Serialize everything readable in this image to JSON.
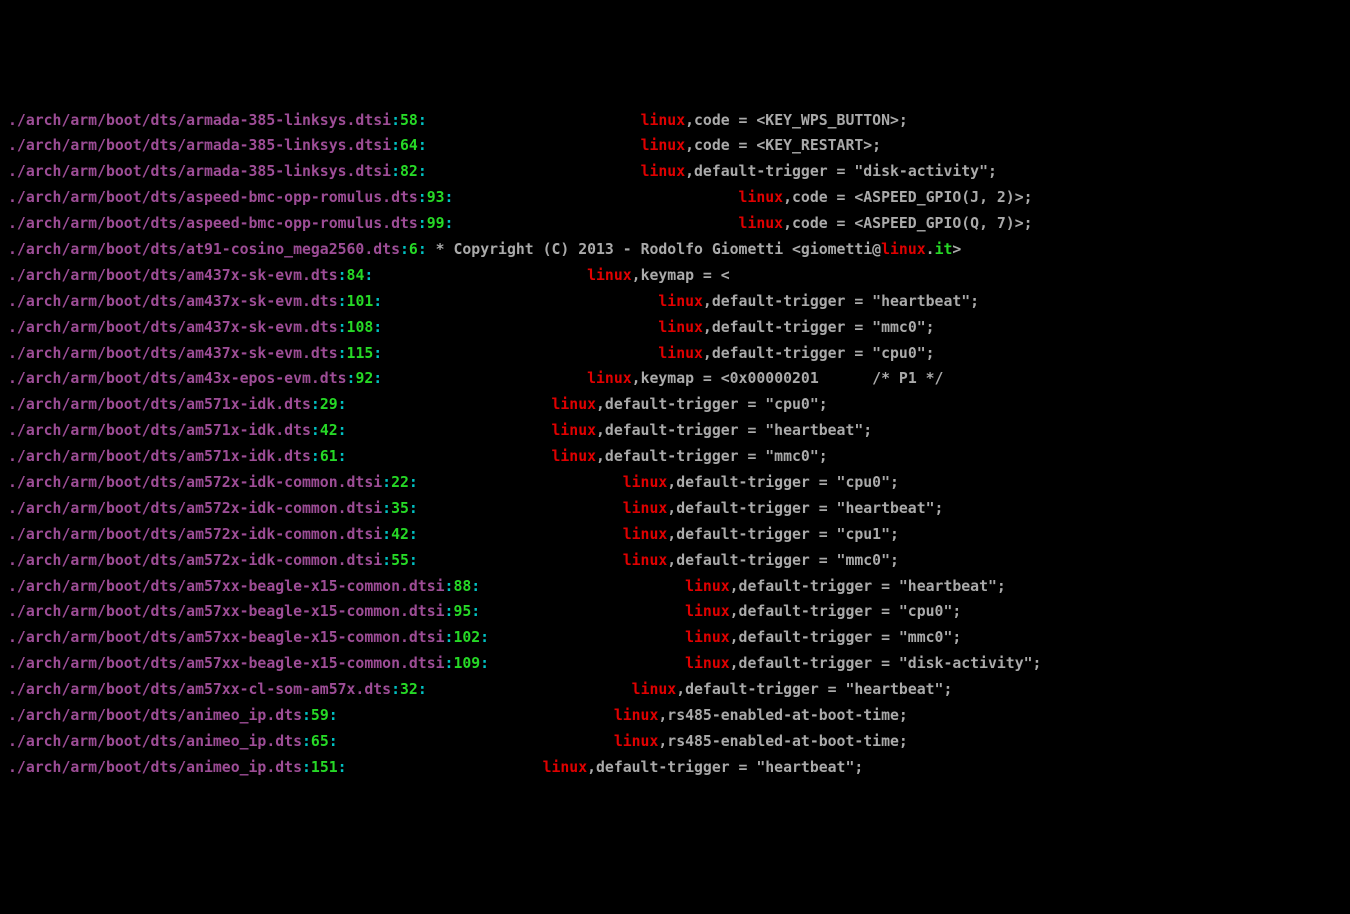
{
  "lines": [
    {
      "path": "./arch/arm/boot/dts/armada-385-linksys.dtsi",
      "lineno": "58",
      "pad": "                        ",
      "prefix": "",
      "linux": "linux",
      "after1": ",code = <KEY_WPS_BUTTON>;"
    },
    {
      "path": "./arch/arm/boot/dts/armada-385-linksys.dtsi",
      "lineno": "64",
      "pad": "                        ",
      "prefix": "",
      "linux": "linux",
      "after1": ",code = <KEY_RESTART>;"
    },
    {
      "path": "./arch/arm/boot/dts/armada-385-linksys.dtsi",
      "lineno": "82",
      "pad": "                        ",
      "prefix": "",
      "linux": "linux",
      "after1": ",default-trigger = \"disk-activity\";"
    },
    {
      "path": "./arch/arm/boot/dts/aspeed-bmc-opp-romulus.dts",
      "lineno": "93",
      "pad": "                                ",
      "prefix": "",
      "linux": "linux",
      "after1": ",code = <ASPEED_GPIO(J, 2)>;"
    },
    {
      "path": "./arch/arm/boot/dts/aspeed-bmc-opp-romulus.dts",
      "lineno": "99",
      "pad": "                                ",
      "prefix": "",
      "linux": "linux",
      "after1": ",code = <ASPEED_GPIO(Q, 7)>;"
    },
    {
      "path": "./arch/arm/boot/dts/at91-cosino_mega2560.dts",
      "lineno": "6",
      "pad": " ",
      "prefix": "* Copyright (C) 2013 - Rodolfo Giometti <giometti@",
      "linux": "linux",
      "after1": ".",
      "it": "it",
      "after2": ">"
    },
    {
      "path": "./arch/arm/boot/dts/am437x-sk-evm.dts",
      "lineno": "84",
      "pad": "                        ",
      "prefix": "",
      "linux": "linux",
      "after1": ",keymap = <"
    },
    {
      "path": "./arch/arm/boot/dts/am437x-sk-evm.dts",
      "lineno": "101",
      "pad": "                               ",
      "prefix": "",
      "linux": "linux",
      "after1": ",default-trigger = \"heartbeat\";"
    },
    {
      "path": "./arch/arm/boot/dts/am437x-sk-evm.dts",
      "lineno": "108",
      "pad": "                               ",
      "prefix": "",
      "linux": "linux",
      "after1": ",default-trigger = \"mmc0\";"
    },
    {
      "path": "./arch/arm/boot/dts/am437x-sk-evm.dts",
      "lineno": "115",
      "pad": "                               ",
      "prefix": "",
      "linux": "linux",
      "after1": ",default-trigger = \"cpu0\";"
    },
    {
      "path": "./arch/arm/boot/dts/am43x-epos-evm.dts",
      "lineno": "92",
      "pad": "                       ",
      "prefix": "",
      "linux": "linux",
      "after1": ",keymap = <0x00000201      /* P1 */"
    },
    {
      "path": "./arch/arm/boot/dts/am571x-idk.dts",
      "lineno": "29",
      "pad": "                       ",
      "prefix": "",
      "linux": "linux",
      "after1": ",default-trigger = \"cpu0\";"
    },
    {
      "path": "./arch/arm/boot/dts/am571x-idk.dts",
      "lineno": "42",
      "pad": "                       ",
      "prefix": "",
      "linux": "linux",
      "after1": ",default-trigger = \"heartbeat\";"
    },
    {
      "path": "./arch/arm/boot/dts/am571x-idk.dts",
      "lineno": "61",
      "pad": "                       ",
      "prefix": "",
      "linux": "linux",
      "after1": ",default-trigger = \"mmc0\";"
    },
    {
      "path": "./arch/arm/boot/dts/am572x-idk-common.dtsi",
      "lineno": "22",
      "pad": "                       ",
      "prefix": "",
      "linux": "linux",
      "after1": ",default-trigger = \"cpu0\";"
    },
    {
      "path": "./arch/arm/boot/dts/am572x-idk-common.dtsi",
      "lineno": "35",
      "pad": "                       ",
      "prefix": "",
      "linux": "linux",
      "after1": ",default-trigger = \"heartbeat\";"
    },
    {
      "path": "./arch/arm/boot/dts/am572x-idk-common.dtsi",
      "lineno": "42",
      "pad": "                       ",
      "prefix": "",
      "linux": "linux",
      "after1": ",default-trigger = \"cpu1\";"
    },
    {
      "path": "./arch/arm/boot/dts/am572x-idk-common.dtsi",
      "lineno": "55",
      "pad": "                       ",
      "prefix": "",
      "linux": "linux",
      "after1": ",default-trigger = \"mmc0\";"
    },
    {
      "path": "./arch/arm/boot/dts/am57xx-beagle-x15-common.dtsi",
      "lineno": "88",
      "pad": "                       ",
      "prefix": "",
      "linux": "linux",
      "after1": ",default-trigger = \"heartbeat\";"
    },
    {
      "path": "./arch/arm/boot/dts/am57xx-beagle-x15-common.dtsi",
      "lineno": "95",
      "pad": "                       ",
      "prefix": "",
      "linux": "linux",
      "after1": ",default-trigger = \"cpu0\";"
    },
    {
      "path": "./arch/arm/boot/dts/am57xx-beagle-x15-common.dtsi",
      "lineno": "102",
      "pad": "                      ",
      "prefix": "",
      "linux": "linux",
      "after1": ",default-trigger = \"mmc0\";"
    },
    {
      "path": "./arch/arm/boot/dts/am57xx-beagle-x15-common.dtsi",
      "lineno": "109",
      "pad": "                      ",
      "prefix": "",
      "linux": "linux",
      "after1": ",default-trigger = \"disk-activity\";"
    },
    {
      "path": "./arch/arm/boot/dts/am57xx-cl-som-am57x.dts",
      "lineno": "32",
      "pad": "                       ",
      "prefix": "",
      "linux": "linux",
      "after1": ",default-trigger = \"heartbeat\";"
    },
    {
      "path": "./arch/arm/boot/dts/animeo_ip.dts",
      "lineno": "59",
      "pad": "                               ",
      "prefix": "",
      "linux": "linux",
      "after1": ",rs485-enabled-at-boot-time;"
    },
    {
      "path": "./arch/arm/boot/dts/animeo_ip.dts",
      "lineno": "65",
      "pad": "                               ",
      "prefix": "",
      "linux": "linux",
      "after1": ",rs485-enabled-at-boot-time;"
    },
    {
      "path": "./arch/arm/boot/dts/animeo_ip.dts",
      "lineno": "151",
      "pad": "                      ",
      "prefix": "",
      "linux": "linux",
      "after1": ",default-trigger = \"heartbeat\";"
    }
  ]
}
